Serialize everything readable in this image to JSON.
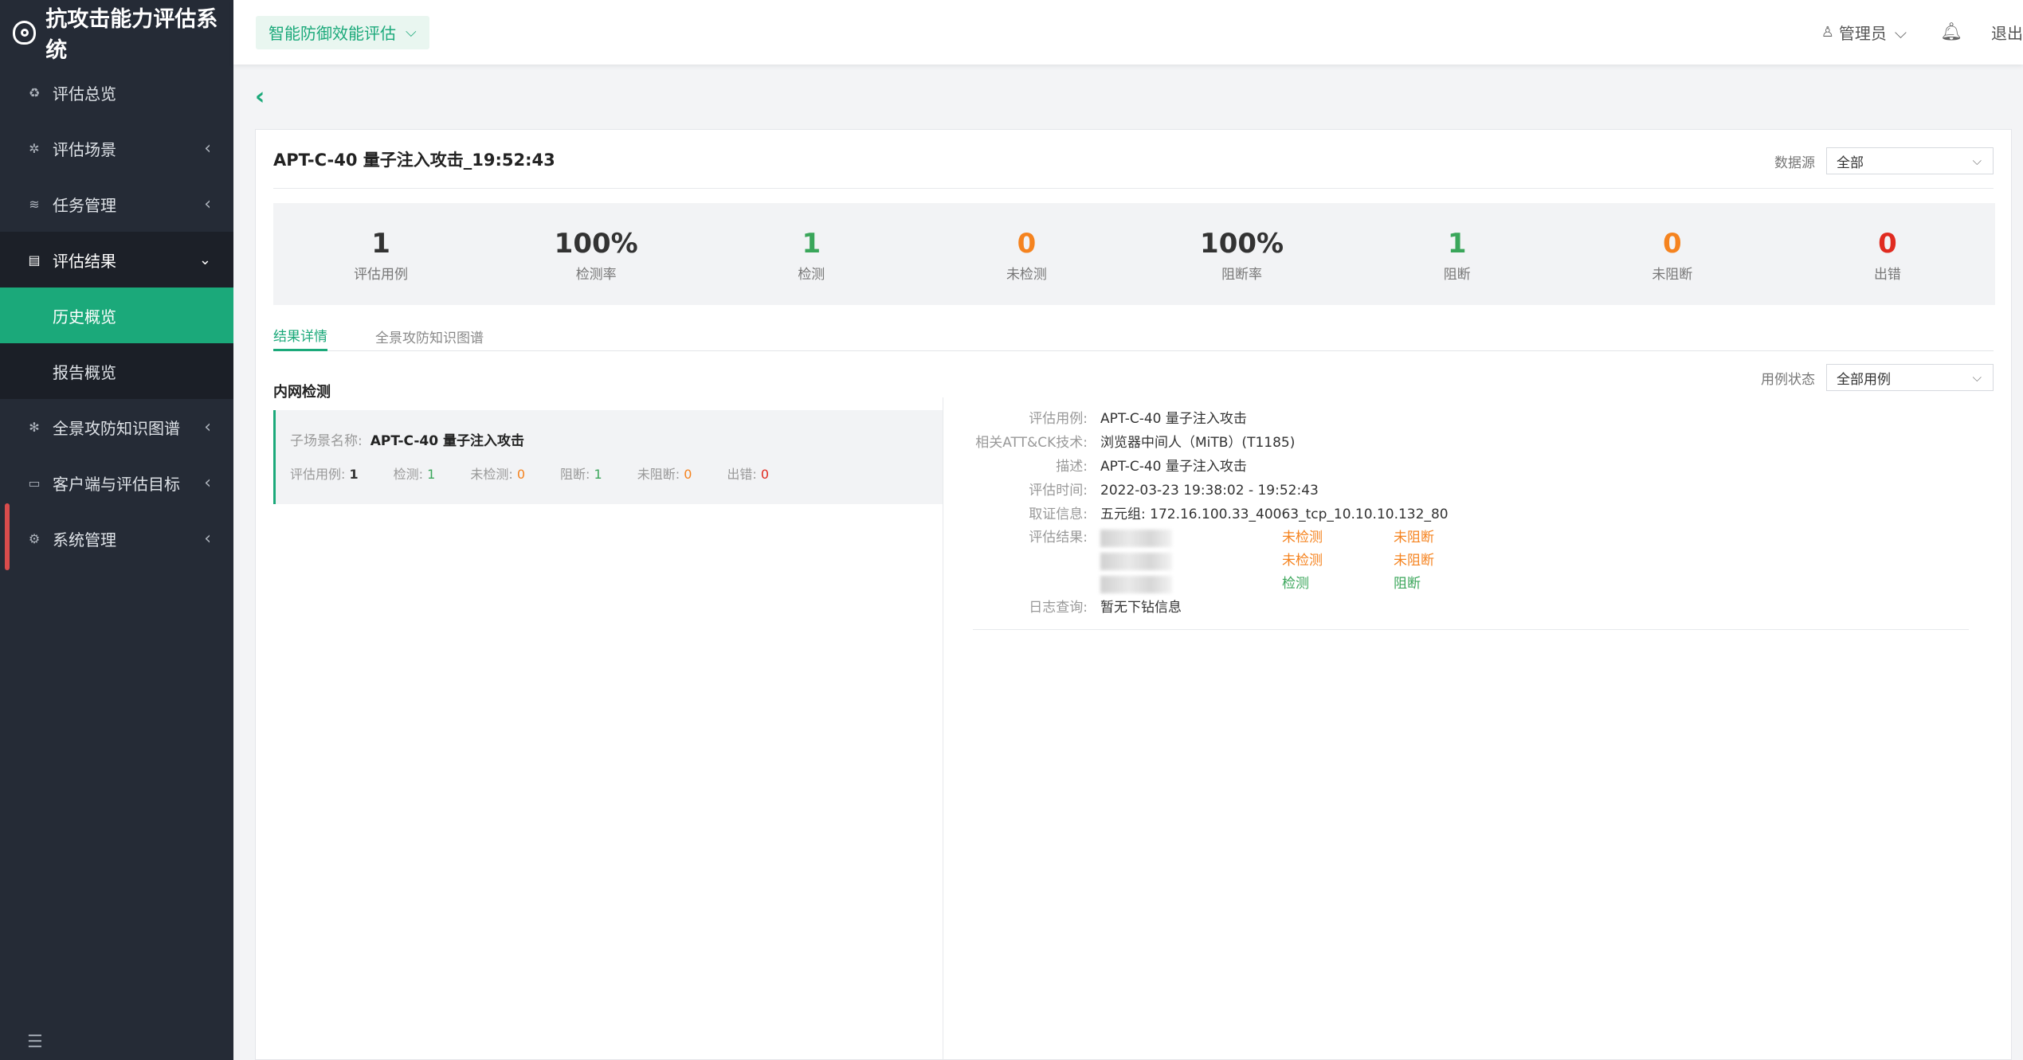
{
  "app": {
    "title": "抗攻击能力评估系统"
  },
  "sidebar": {
    "items": [
      {
        "label": "评估总览",
        "icon": "overview-icon"
      },
      {
        "label": "评估场景",
        "icon": "gear-icon"
      },
      {
        "label": "任务管理",
        "icon": "layers-icon"
      },
      {
        "label": "评估结果",
        "icon": "clipboard-icon"
      },
      {
        "label": "全景攻防知识图谱",
        "icon": "graph-icon"
      },
      {
        "label": "客户端与评估目标",
        "icon": "monitor-icon"
      },
      {
        "label": "系统管理",
        "icon": "settings-icon"
      }
    ],
    "submenu": [
      {
        "label": "历史概览"
      },
      {
        "label": "报告概览"
      }
    ]
  },
  "header": {
    "module": "智能防御效能评估",
    "user": "管理员",
    "logout": "退出"
  },
  "main": {
    "title": "APT-C-40 量子注入攻击_19:52:43",
    "datasource_label": "数据源",
    "datasource_value": "全部",
    "stats": [
      {
        "value": "1",
        "label": "评估用例",
        "color": "#333333"
      },
      {
        "value": "100%",
        "label": "检测率",
        "color": "#333333"
      },
      {
        "value": "1",
        "label": "检测",
        "color": "#3aa65a"
      },
      {
        "value": "0",
        "label": "未检测",
        "color": "#f5831f"
      },
      {
        "value": "100%",
        "label": "阻断率",
        "color": "#333333"
      },
      {
        "value": "1",
        "label": "阻断",
        "color": "#3aa65a"
      },
      {
        "value": "0",
        "label": "未阻断",
        "color": "#f5831f"
      },
      {
        "value": "0",
        "label": "出错",
        "color": "#e02b20"
      }
    ],
    "tabs": [
      {
        "label": "结果详情"
      },
      {
        "label": "全景攻防知识图谱"
      }
    ],
    "section_title": "内网检测",
    "case_status_label": "用例状态",
    "case_status_value": "全部用例",
    "scene": {
      "name_label": "子场景名称:",
      "name": "APT-C-40 量子注入攻击",
      "stats": {
        "cases_label": "评估用例:",
        "cases": "1",
        "detect_label": "检测:",
        "detect": "1",
        "undetect_label": "未检测:",
        "undetect": "0",
        "block_label": "阻断:",
        "block": "1",
        "unblock_label": "未阻断:",
        "unblock": "0",
        "error_label": "出错:",
        "error": "0"
      }
    },
    "detail": {
      "case_label": "评估用例:",
      "case": "APT-C-40 量子注入攻击",
      "tech_label": "相关ATT&CK技术:",
      "tech": "浏览器中间人（MiTB）(T1185)",
      "desc_label": "描述:",
      "desc": "APT-C-40 量子注入攻击",
      "time_label": "评估时间:",
      "time": "2022-03-23 19:38:02 - 19:52:43",
      "evidence_label": "取证信息:",
      "evidence": "五元组: 172.16.100.33_40063_tcp_10.10.10.132_80",
      "result_label": "评估结果:",
      "results": [
        {
          "detect": "未检测",
          "block": "未阻断",
          "detect_color": "#f5831f",
          "block_color": "#f5831f"
        },
        {
          "detect": "未检测",
          "block": "未阻断",
          "detect_color": "#f5831f",
          "block_color": "#f5831f"
        },
        {
          "detect": "检测",
          "block": "阻断",
          "detect_color": "#3aa65a",
          "block_color": "#3aa65a"
        }
      ],
      "log_label": "日志查询:",
      "log": "暂无下钻信息"
    }
  }
}
